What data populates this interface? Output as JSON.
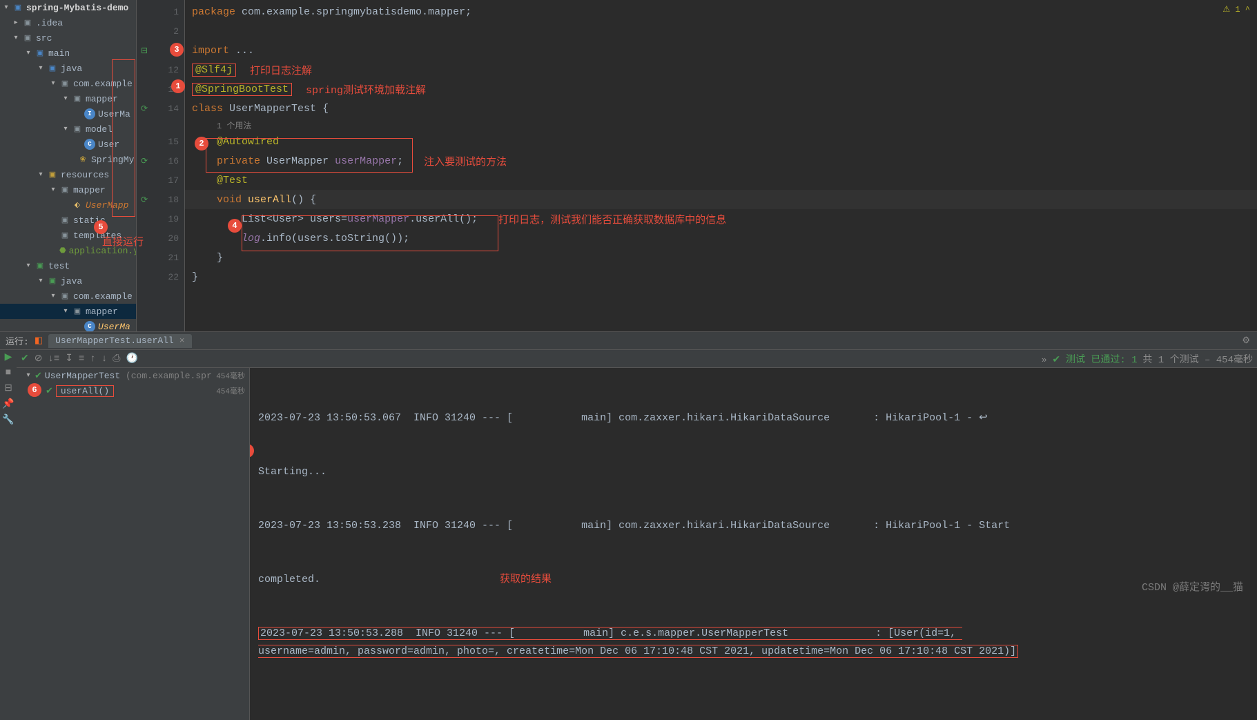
{
  "project": {
    "name": "spring-Mybatis-demo",
    "tree": {
      "idea": ".idea",
      "src": "src",
      "main": "main",
      "java": "java",
      "pkg_main": "com.example",
      "mapper_pkg": "mapper",
      "usermapper": "UserMa",
      "model": "model",
      "user": "User",
      "springmy": "SpringMy",
      "resources": "resources",
      "mapper_res": "mapper",
      "usermapper_xml": "UserMapp",
      "static": "static",
      "templates": "templates",
      "app_yml": "application.yml",
      "test": "test",
      "java_test": "java",
      "pkg_test": "com.example",
      "mapper_test": "mapper",
      "usermapper_test": "UserMa"
    }
  },
  "annotations": {
    "log": "打印日志注解",
    "spring": "spring测试环境加载注解",
    "inject": "注入要测试的方法",
    "print": "打印日志，测试我们能否正确获取数据库中的信息",
    "run_direct": "直接运行",
    "result": "获取的结果"
  },
  "code": {
    "usage_hint": "1 个用法",
    "line1": "package com.example.springmybatisdemo.mapper;",
    "lines": {
      "l1": {
        "n": "1"
      },
      "l2": {
        "n": "2"
      },
      "l3": {
        "n": "3"
      },
      "l12": {
        "n": "12"
      },
      "l13": {
        "n": "13"
      },
      "l14": {
        "n": "14"
      },
      "l15": {
        "n": "15"
      },
      "l16": {
        "n": "16"
      },
      "l17": {
        "n": "17"
      },
      "l18": {
        "n": "18"
      },
      "l19": {
        "n": "19"
      },
      "l20": {
        "n": "20"
      },
      "l21": {
        "n": "21"
      },
      "l22": {
        "n": "22"
      }
    },
    "tok": {
      "package": "package",
      "import": "import",
      "class": "class",
      "private": "private",
      "void": "void",
      "ellipsis": " ...",
      "slf4j": "@Slf4j",
      "sbt": "@SpringBootTest",
      "autowired": "@Autowired",
      "test": "@Test",
      "classname": "UserMapperTest",
      "obrace": " {",
      "cbrace": "}",
      "usermapper_type": " UserMapper ",
      "usermapper_var": "userMapper",
      "semi": ";",
      "userall": "userAll",
      "paren": "() {",
      "list_user": "List<User> ",
      "users_eq": "users=",
      "dot_userall": ".userAll();",
      "log_var": "log",
      "info_call": ".info(users.toString());"
    }
  },
  "warnings": {
    "top": "1"
  },
  "run": {
    "label": "运行:",
    "tab": "UserMapperTest.userAll",
    "status_prefix": "测试 已通过: 1",
    "status_suffix": "共 1 个测试 – 454毫秒",
    "tree": {
      "root": "UserMapperTest",
      "root_loc": "(com.example.spr",
      "root_dur": "454毫秒",
      "method": "userAll()",
      "method_dur": "454毫秒"
    },
    "console": {
      "l1": "2023-07-23 13:50:53.067  INFO 31240 --- [           main] com.zaxxer.hikari.HikariDataSource       : HikariPool-1 - ",
      "l1b": "Starting...",
      "l2": "2023-07-23 13:50:53.238  INFO 31240 --- [           main] com.zaxxer.hikari.HikariDataSource       : HikariPool-1 - Start ",
      "l2b": "completed.",
      "l3": "2023-07-23 13:50:53.288  INFO 31240 --- [           main] c.e.s.mapper.UserMapperTest              : [User(id=1, ",
      "l3b": "username=admin, password=admin, photo=, createtime=Mon Dec 06 17:10:48 CST 2021, updatetime=Mon Dec 06 17:10:48 CST 2021)]"
    }
  },
  "watermark": "CSDN @薛定谔的__猫"
}
